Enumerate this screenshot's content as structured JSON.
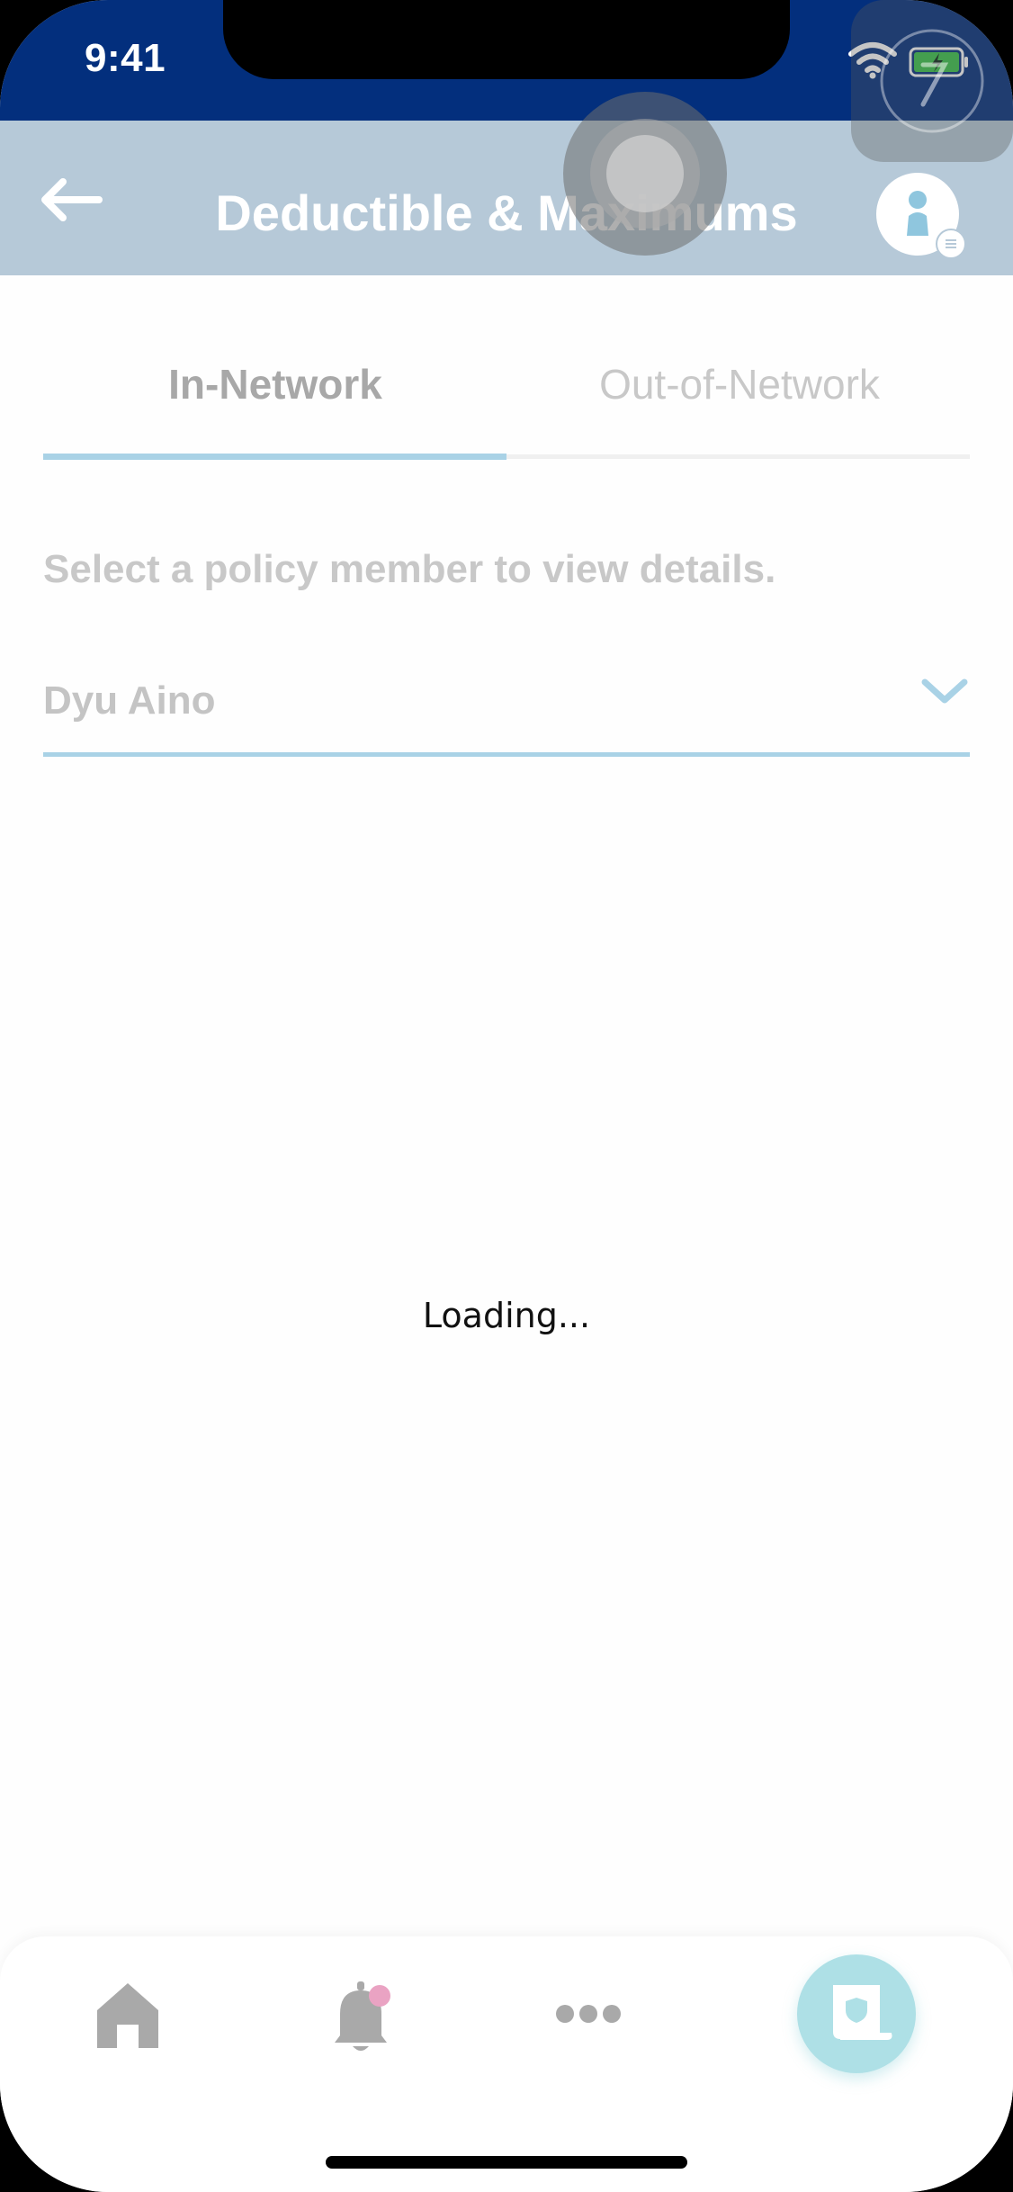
{
  "status_bar": {
    "time": "9:41"
  },
  "header": {
    "title": "Deductible & Maximums"
  },
  "tabs": [
    {
      "label": "In-Network",
      "selected": true
    },
    {
      "label": "Out-of-Network",
      "selected": false
    }
  ],
  "instruction": "Select a policy member to view details.",
  "member_select": {
    "value": "Dyu Aino"
  },
  "loading_text": "Loading...",
  "bottom_nav": {
    "items": [
      {
        "icon": "home-icon"
      },
      {
        "icon": "bell-icon",
        "has_badge": true
      },
      {
        "icon": "more-icon"
      },
      {
        "icon": "policy-card-icon",
        "active": true
      }
    ]
  },
  "colors": {
    "status_bar": "#032f7d",
    "header": "#b6c9d8",
    "accent": "#a9d2e6",
    "active_nav": "#aee0e6",
    "badge": "#eaa3c3"
  }
}
